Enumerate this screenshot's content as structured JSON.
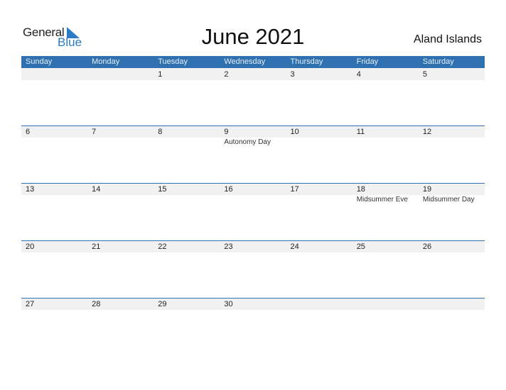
{
  "logo": {
    "word1": "General",
    "word2": "Blue"
  },
  "title": "June 2021",
  "country": "Aland Islands",
  "colors": {
    "accent": "#2e70b0",
    "strip": "#f1f1f1",
    "logo_blue": "#2a7bc4"
  },
  "weekdays": [
    "Sunday",
    "Monday",
    "Tuesday",
    "Wednesday",
    "Thursday",
    "Friday",
    "Saturday"
  ],
  "weeks": [
    [
      {
        "d": ""
      },
      {
        "d": ""
      },
      {
        "d": "1"
      },
      {
        "d": "2"
      },
      {
        "d": "3"
      },
      {
        "d": "4"
      },
      {
        "d": "5"
      }
    ],
    [
      {
        "d": "6"
      },
      {
        "d": "7"
      },
      {
        "d": "8"
      },
      {
        "d": "9",
        "ev": "Autonomy Day"
      },
      {
        "d": "10"
      },
      {
        "d": "11"
      },
      {
        "d": "12"
      }
    ],
    [
      {
        "d": "13"
      },
      {
        "d": "14"
      },
      {
        "d": "15"
      },
      {
        "d": "16"
      },
      {
        "d": "17"
      },
      {
        "d": "18",
        "ev": "Midsummer Eve"
      },
      {
        "d": "19",
        "ev": "Midsummer Day"
      }
    ],
    [
      {
        "d": "20"
      },
      {
        "d": "21"
      },
      {
        "d": "22"
      },
      {
        "d": "23"
      },
      {
        "d": "24"
      },
      {
        "d": "25"
      },
      {
        "d": "26"
      }
    ],
    [
      {
        "d": "27"
      },
      {
        "d": "28"
      },
      {
        "d": "29"
      },
      {
        "d": "30"
      },
      {
        "d": ""
      },
      {
        "d": ""
      },
      {
        "d": ""
      }
    ]
  ]
}
